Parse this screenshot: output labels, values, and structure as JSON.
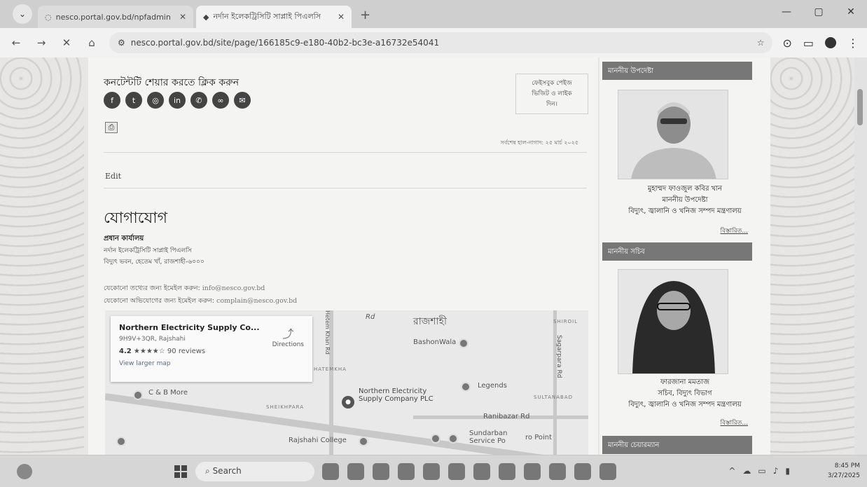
{
  "browser": {
    "tabs": [
      {
        "title": "nesco.portal.gov.bd/npfadmin",
        "active": false
      },
      {
        "title": "নর্দান ইলেকট্রিসিটি সাপ্লাই পিএলসি",
        "active": true
      }
    ],
    "url": "nesco.portal.gov.bd/site/page/166185c9-e180-40b2-bc3e-a16732e54041",
    "icons": [
      "back-icon",
      "forward-icon",
      "close-icon",
      "home-icon",
      "site-info-icon",
      "star-icon",
      "extensions-icon",
      "profile-icon",
      "menu-icon"
    ]
  },
  "content": {
    "share_title": "কনটেন্টটি শেয়ার করতে ক্লিক করুন",
    "share_icons": [
      "facebook-icon",
      "twitter-icon",
      "share-icon",
      "linkedin-icon",
      "whatsapp-icon",
      "link-icon",
      "messenger-icon"
    ],
    "fb_box": [
      "ফেইসবুক পেইজ",
      "ভিজিট ও লাইক",
      "দিন।"
    ],
    "updated": "সর্বশেষ হাল-নাগাদ: ২৫ মার্চ ২০২৫",
    "edit": "Edit",
    "heading": "যোগাযোগ",
    "office_label": "প্রধান কার্যালয়",
    "address": [
      "নর্দান ইলেকট্রিসিটি সাপ্লাই পিএলসি",
      "বিদ্যুৎ ভবন, হেতেম খাঁ, রাজশাহী-৬০০০"
    ],
    "info_prefix": "যেকোনো তথ্যের জন্য ইমেইল করুন:",
    "info_email": "info@nesco.gov.bd",
    "complain_prefix": "যেকোনো অভিযোগের জন্য ইমেইল করুন:",
    "complain_email": "complain@nesco.gov.bd"
  },
  "map": {
    "place_name": "Northern Electricity Supply Co...",
    "plus_code": "9H9V+3QR, Rajshahi",
    "rating": "4.2",
    "stars": "★★★★☆",
    "reviews": "90 reviews",
    "larger_map": "View larger map",
    "directions": "Directions",
    "labels": {
      "bashonwala": "BashonWala",
      "hatemkha": "HATEMKHA",
      "legends": "Legends",
      "sultanabad": "SULTANABAD",
      "shiroil": "SHIROIL",
      "sheikhpara": "SHEIKHPARA",
      "ranibazar": "Ranibazar Rd",
      "cb_more": "C & B More",
      "rajshahi_college": "Rajshahi College",
      "sundarban": "Sundarban Service Po",
      "nesco": "Northern Electricity Supply Company PLC",
      "rajshahi_bn": "রাজশাহী",
      "sagarpara": "Sagarpara Rd",
      "rd": "Rd",
      "hetem_khan": "Hetem Khan Rd",
      "ro_point": "ro Point"
    }
  },
  "sidebar": {
    "advisor_head": "মাননীয় উপদেষ্টা",
    "advisor_name": "মুহাম্মদ ফাওজুল কবির খান",
    "advisor_title": "মাননীয় উপদেষ্টা",
    "advisor_ministry": "বিদ্যুৎ, জ্বালানি ও খনিজ সম্পদ মন্ত্রণালয়",
    "advisor_detail": "বিস্তারিত...",
    "secretary_head": "মাননীয় সচিব",
    "secretary_name": "ফারজানা মমতাজ",
    "secretary_title": "সচিব, বিদ্যুৎ বিভাগ",
    "secretary_ministry": "বিদ্যুৎ, জ্বালানি ও খনিজ সম্পদ মন্ত্রণালয়",
    "secretary_detail": "বিস্তারিত...",
    "chairman_head": "মাননীয় চেয়ারম্যান"
  },
  "taskbar": {
    "search_label": "Search",
    "time": "8:45 PM",
    "date": "3/27/2025"
  }
}
